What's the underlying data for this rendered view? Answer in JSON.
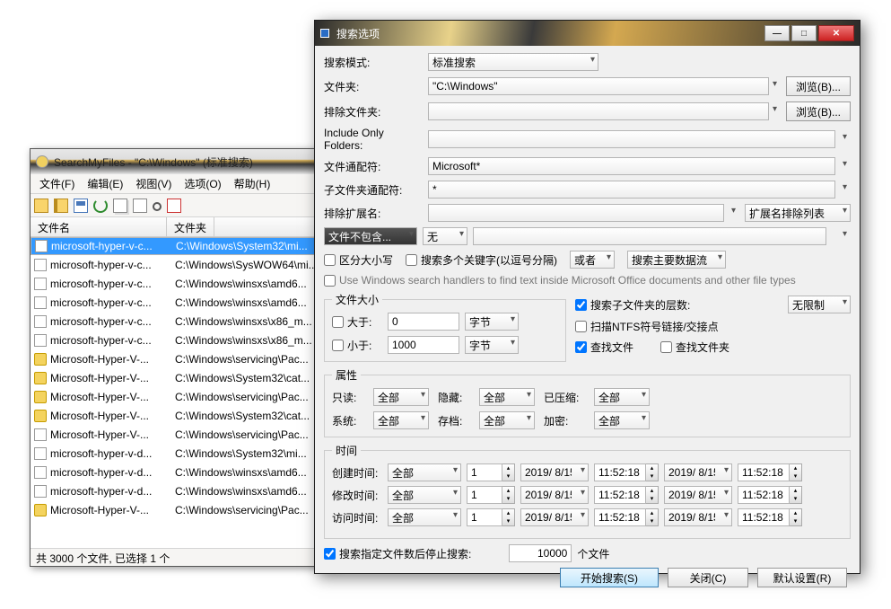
{
  "back": {
    "title": "SearchMyFiles  -  \"C:\\Windows\"  (标准搜索)",
    "menu": {
      "file": "文件(F)",
      "edit": "编辑(E)",
      "view": "视图(V)",
      "options": "选项(O)",
      "help": "帮助(H)"
    },
    "cols": {
      "name": "文件名",
      "folder": "文件夹"
    },
    "rows": [
      {
        "sel": true,
        "icon": "file",
        "name": "microsoft-hyper-v-c...",
        "path": "C:\\Windows\\System32\\mi..."
      },
      {
        "sel": false,
        "icon": "file",
        "name": "microsoft-hyper-v-c...",
        "path": "C:\\Windows\\SysWOW64\\mi..."
      },
      {
        "sel": false,
        "icon": "file",
        "name": "microsoft-hyper-v-c...",
        "path": "C:\\Windows\\winsxs\\amd6..."
      },
      {
        "sel": false,
        "icon": "file",
        "name": "microsoft-hyper-v-c...",
        "path": "C:\\Windows\\winsxs\\amd6..."
      },
      {
        "sel": false,
        "icon": "file",
        "name": "microsoft-hyper-v-c...",
        "path": "C:\\Windows\\winsxs\\x86_m..."
      },
      {
        "sel": false,
        "icon": "file",
        "name": "microsoft-hyper-v-c...",
        "path": "C:\\Windows\\winsxs\\x86_m..."
      },
      {
        "sel": false,
        "icon": "cat",
        "name": "Microsoft-Hyper-V-...",
        "path": "C:\\Windows\\servicing\\Pac..."
      },
      {
        "sel": false,
        "icon": "cat",
        "name": "Microsoft-Hyper-V-...",
        "path": "C:\\Windows\\System32\\cat..."
      },
      {
        "sel": false,
        "icon": "cat",
        "name": "Microsoft-Hyper-V-...",
        "path": "C:\\Windows\\servicing\\Pac..."
      },
      {
        "sel": false,
        "icon": "cat",
        "name": "Microsoft-Hyper-V-...",
        "path": "C:\\Windows\\System32\\cat..."
      },
      {
        "sel": false,
        "icon": "file",
        "name": "Microsoft-Hyper-V-...",
        "path": "C:\\Windows\\servicing\\Pac..."
      },
      {
        "sel": false,
        "icon": "file",
        "name": "microsoft-hyper-v-d...",
        "path": "C:\\Windows\\System32\\mi..."
      },
      {
        "sel": false,
        "icon": "file",
        "name": "microsoft-hyper-v-d...",
        "path": "C:\\Windows\\winsxs\\amd6..."
      },
      {
        "sel": false,
        "icon": "file",
        "name": "microsoft-hyper-v-d...",
        "path": "C:\\Windows\\winsxs\\amd6..."
      },
      {
        "sel": false,
        "icon": "cat",
        "name": "Microsoft-Hyper-V-...",
        "path": "C:\\Windows\\servicing\\Pac..."
      }
    ],
    "status": "共 3000 个文件, 已选择 1 个"
  },
  "dlg": {
    "title": "搜索选项",
    "labels": {
      "mode": "搜索模式:",
      "folder": "文件夹:",
      "exclude_folder": "排除文件夹:",
      "include_only": "Include Only Folders:",
      "wildcard": "文件通配符:",
      "sub_wildcard": "子文件夹通配符:",
      "exclude_ext": "排除扩展名:",
      "not_contain": "文件不包含...",
      "none": "无",
      "case": "区分大小写",
      "multi_kw": "搜索多个关键字(以逗号分隔)",
      "or": "或者",
      "main_stream": "搜索主要数据流",
      "use_win": "Use Windows search handlers to find text inside Microsoft Office documents and other file types",
      "filesize": "文件大小",
      "gt": "大于:",
      "lt": "小于:",
      "bytes": "字节",
      "sub_levels": "搜索子文件夹的层数:",
      "unlimited": "无限制",
      "ntfs": "扫描NTFS符号链接/交接点",
      "find_files": "查找文件",
      "find_folders": "查找文件夹",
      "attrs": "属性",
      "readonly": "只读:",
      "hidden": "隐藏:",
      "compressed": "已压缩:",
      "system": "系统:",
      "archive": "存档:",
      "encrypted": "加密:",
      "all": "全部",
      "time": "时间",
      "ctime": "创建时间:",
      "mtime": "修改时间:",
      "atime": "访问时间:",
      "stop_after": "搜索指定文件数后停止搜索:",
      "files_unit": "个文件",
      "ext_exclude_list": "扩展名排除列表"
    },
    "values": {
      "mode": "标准搜索",
      "folder": "\"C:\\Windows\"",
      "wildcard": "Microsoft*",
      "sub_wildcard": "*",
      "gt": "0",
      "lt": "1000",
      "date": "2019/ 8/15",
      "tm": "11:52:18",
      "one": "1",
      "stop_count": "10000"
    },
    "buttons": {
      "browse": "浏览(B)...",
      "start": "开始搜索(S)",
      "close": "关闭(C)",
      "defaults": "默认设置(R)"
    }
  }
}
